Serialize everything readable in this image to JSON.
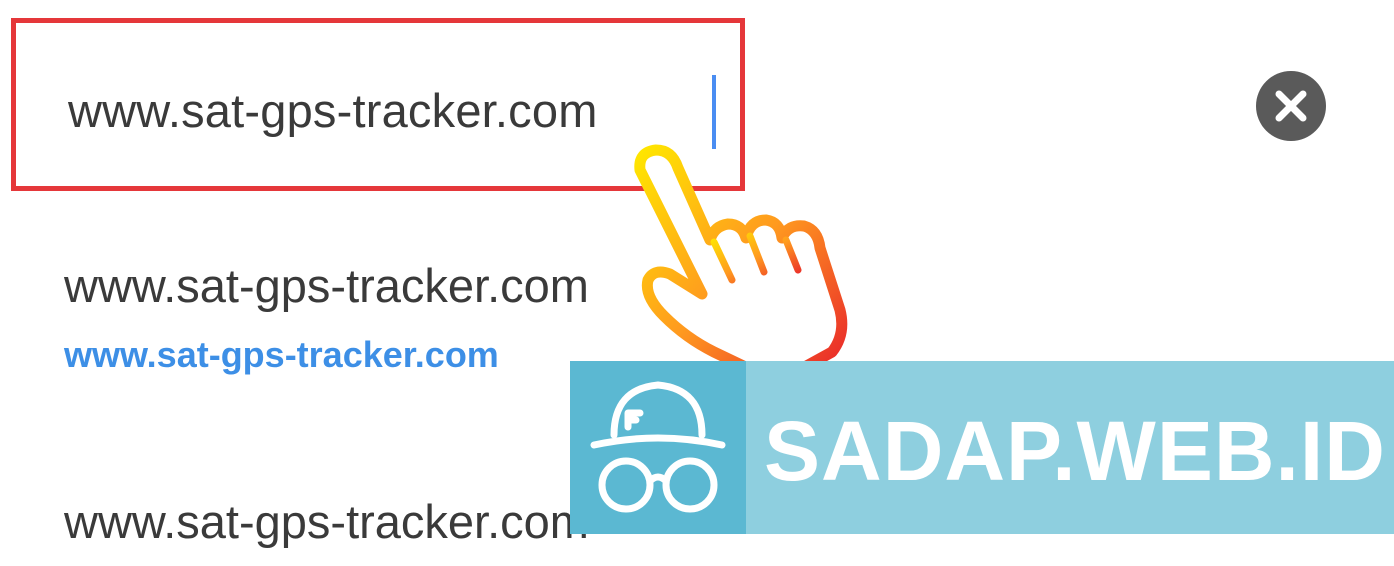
{
  "address_bar": {
    "value": "www.sat-gps-tracker.com"
  },
  "clear_button": {
    "icon": "close-icon"
  },
  "suggestions": [
    {
      "title": "www.sat-gps-tracker.com",
      "url": "www.sat-gps-tracker.com"
    },
    {
      "title": "www.sat-gps-tracker.com",
      "url": ""
    }
  ],
  "overlay": {
    "hand_icon": "pointing-hand-icon",
    "watermark_icon": "incognito-icon",
    "watermark_text": "SADAP.WEB.ID"
  },
  "colors": {
    "highlight_border": "#e5373a",
    "caret": "#4a8df2",
    "link": "#3d8fe6",
    "banner": "#8ecfdf",
    "banner_icon_bg": "#5bb8d2"
  }
}
